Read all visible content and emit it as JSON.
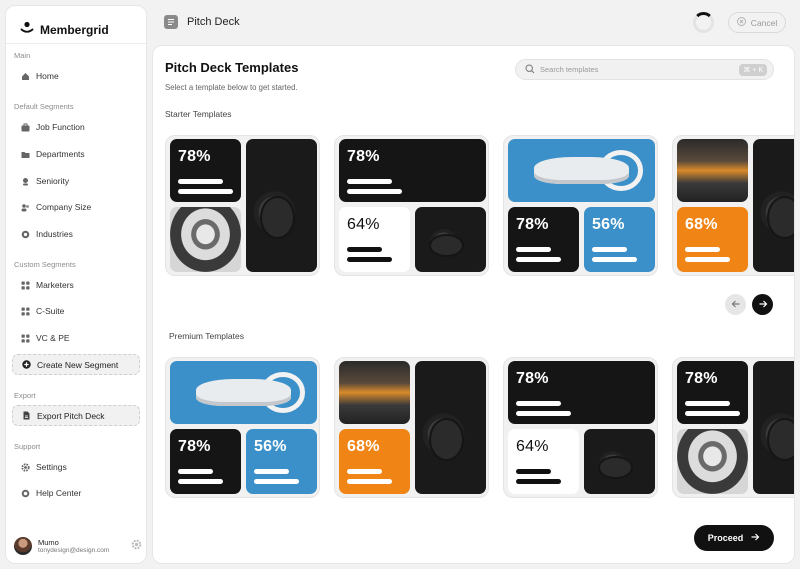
{
  "app": {
    "name": "Membergrid"
  },
  "sidebar": {
    "sections": {
      "main": "Main",
      "default_segments": "Default Segments",
      "custom_segments": "Custom Segments",
      "export": "Export",
      "support": "Support"
    },
    "items": {
      "home": "Home",
      "job_function": "Job Function",
      "departments": "Departments",
      "seniority": "Seniority",
      "company_size": "Company Size",
      "industries": "Industries",
      "marketers": "Marketers",
      "c_suite": "C-Suite",
      "vc_pe": "VC & PE",
      "create_segment": "Create New Segment",
      "export_pitch_deck": "Export Pitch Deck",
      "settings": "Settings",
      "help_center": "Help Center"
    },
    "user": {
      "name": "Mumo",
      "email": "tonydesign@design.com"
    }
  },
  "header": {
    "title": "Pitch Deck",
    "cancel": "Cancel"
  },
  "main": {
    "title": "Pitch Deck Templates",
    "subtitle": "Select a template below to get started.",
    "search_placeholder": "Search templates",
    "search_shortcut": "⌘ + K",
    "starter_title": "Starter Templates",
    "premium_title": "Premium Templates",
    "proceed": "Proceed"
  },
  "cards": {
    "s1": {
      "a": "78%"
    },
    "s2": {
      "a": "78%",
      "b": "64%"
    },
    "s3": {
      "a": "78%",
      "b": "56%"
    },
    "s4": {
      "a": "68%"
    },
    "p1": {
      "a": "78%",
      "b": "56%"
    },
    "p2": {
      "a": "68%"
    },
    "p3": {
      "a": "78%",
      "b": "64%"
    },
    "p4": {
      "a": "78%"
    }
  },
  "colors": {
    "accent_dark": "#111111",
    "blue": "#3b90c9",
    "orange": "#f08414"
  }
}
